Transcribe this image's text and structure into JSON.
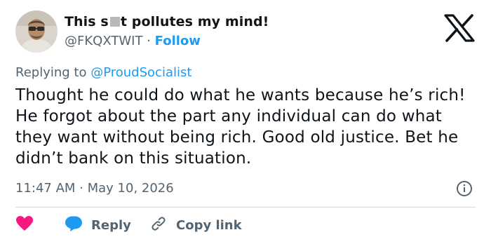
{
  "tweet": {
    "author": {
      "name_start": "This s",
      "name_end": "t pollutes my mind!",
      "handle": "@FKQXTWIT",
      "separator": "·",
      "follow_label": "Follow"
    },
    "replying_prefix": "Replying to",
    "replying_to": "@ProudSocialist",
    "text": "Thought he could do what he wants because he’s rich! He forgot about the part any individual can do what they want without being rich. Good old justice. Bet he didn’t bank on this situation.",
    "timestamp": "11:47 AM · May 10, 2026",
    "actions": {
      "reply_label": "Reply",
      "copy_link_label": "Copy link"
    }
  },
  "icons": {
    "brand": "x-logo",
    "like": "heart-icon",
    "reply": "speech-bubble-icon",
    "copy": "link-icon",
    "info": "info-icon"
  },
  "colors": {
    "accent": "#1d9bf0",
    "like": "#f91880",
    "text": "#0f1419",
    "muted": "#536471",
    "divider": "#cfd9de"
  }
}
